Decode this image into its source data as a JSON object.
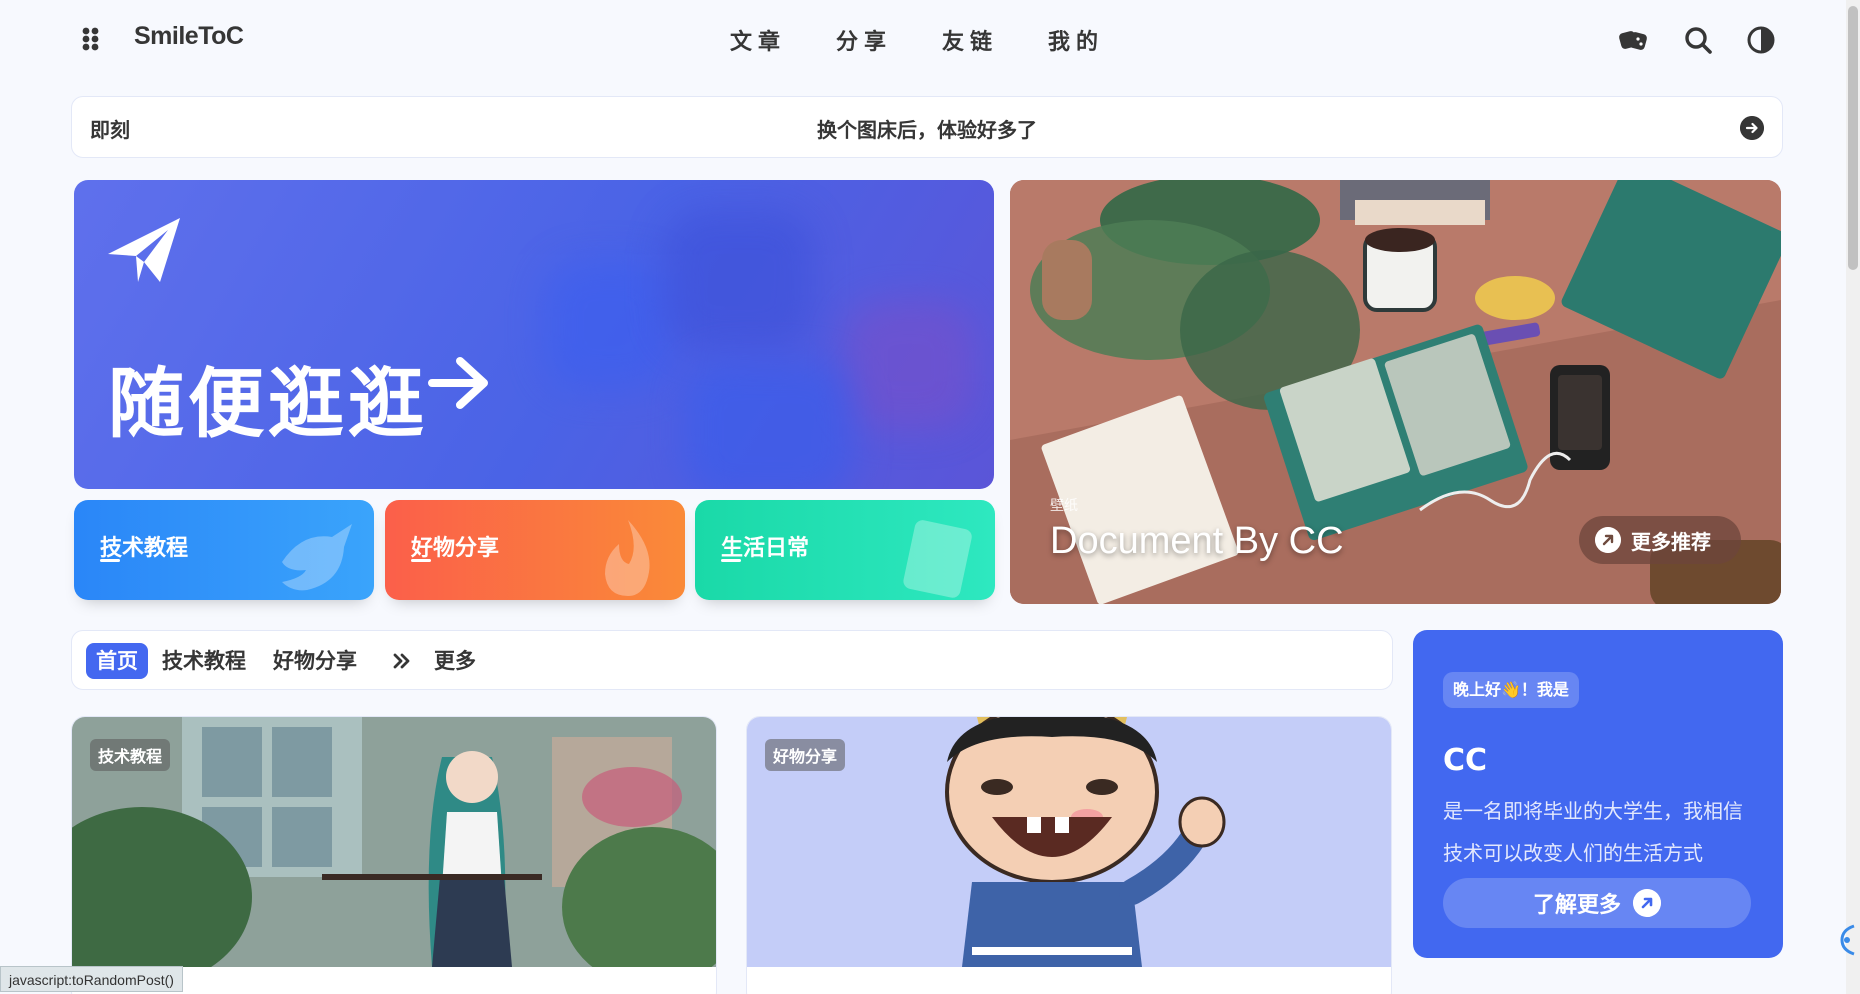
{
  "header": {
    "brand": "SmileToC",
    "nav": [
      "文章",
      "分享",
      "友链",
      "我的"
    ]
  },
  "bulletin": {
    "label": "即刻",
    "text": "换个图床后，体验好多了"
  },
  "random_card": {
    "title": "随便逛逛"
  },
  "categories": [
    {
      "label": "技术教程",
      "color": "#2f8cf9"
    },
    {
      "label": "好物分享",
      "color": "#f96f45"
    },
    {
      "label": "生活日常",
      "color": "#22dcb0"
    }
  ],
  "featured": {
    "tag": "壁纸",
    "title": "Document By CC",
    "more_label": "更多推荐"
  },
  "tabs": {
    "items": [
      "首页",
      "技术教程",
      "好物分享"
    ],
    "more": "更多"
  },
  "posts": [
    {
      "badge": "技术教程"
    },
    {
      "badge": "好物分享"
    }
  ],
  "author": {
    "greeting": "晚上好👋！我是",
    "name": "CC",
    "description": "是一名即将毕业的大学生，我相信技术可以改变人们的生活方式",
    "button": "了解更多"
  },
  "status_bar": "javascript:toRandomPost()",
  "colors": {
    "accent": "#4268f0",
    "background": "#f7f9fe"
  }
}
